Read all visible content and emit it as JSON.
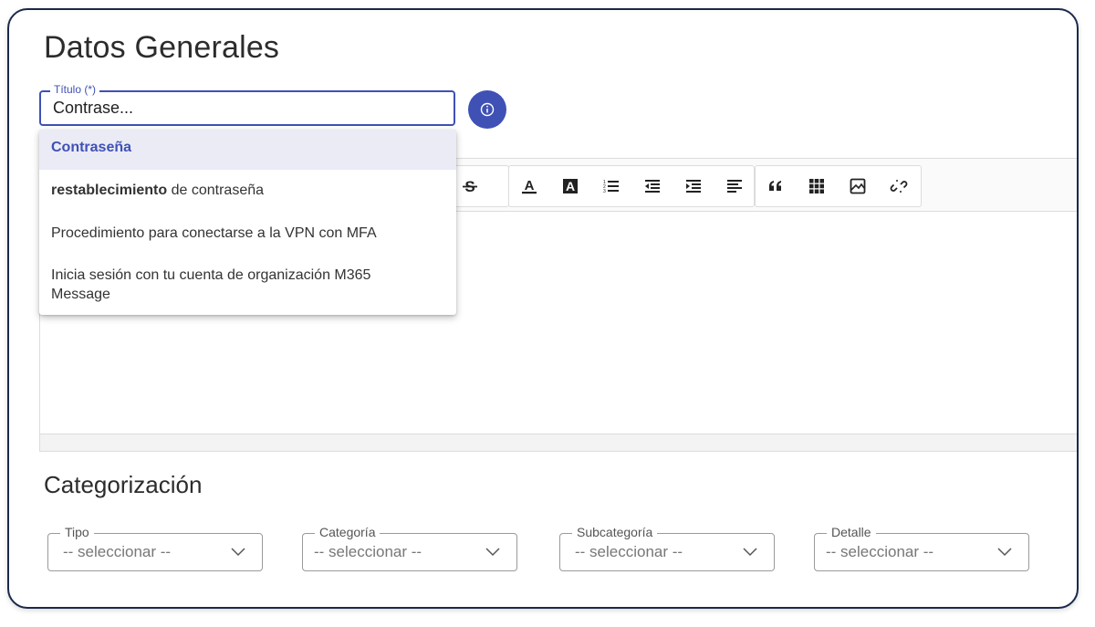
{
  "page": {
    "title": "Datos Generales"
  },
  "title_field": {
    "label": "Título (*)",
    "value": "Contrase..."
  },
  "info_button": {
    "icon": "info-icon"
  },
  "suggestions": {
    "items": [
      {
        "label": "Contraseña"
      },
      {
        "bold": "restablecimiento",
        "rest": " de contraseña"
      },
      {
        "label": "Procedimiento para conectarse a la VPN con MFA"
      },
      {
        "line1": "Inicia sesión con tu cuenta de organización M365",
        "line2": "Message"
      }
    ]
  },
  "toolbar": {
    "icons": [
      "strikethrough-icon",
      "text-color-icon",
      "highlight-color-icon",
      "ordered-list-icon",
      "outdent-icon",
      "indent-icon",
      "align-left-icon",
      "blockquote-icon",
      "table-icon",
      "image-icon",
      "unlink-icon"
    ]
  },
  "categorization": {
    "title": "Categorización",
    "selects": [
      {
        "label": "Tipo",
        "value": "-- seleccionar --"
      },
      {
        "label": "Categoría",
        "value": "-- seleccionar --"
      },
      {
        "label": "Subcategoría",
        "value": "-- seleccionar --"
      },
      {
        "label": "Detalle",
        "value": "-- seleccionar --"
      }
    ]
  },
  "colors": {
    "accent": "#3f51b5",
    "frame": "#1b2a4a",
    "highlight_bg": "#ebebf6"
  }
}
